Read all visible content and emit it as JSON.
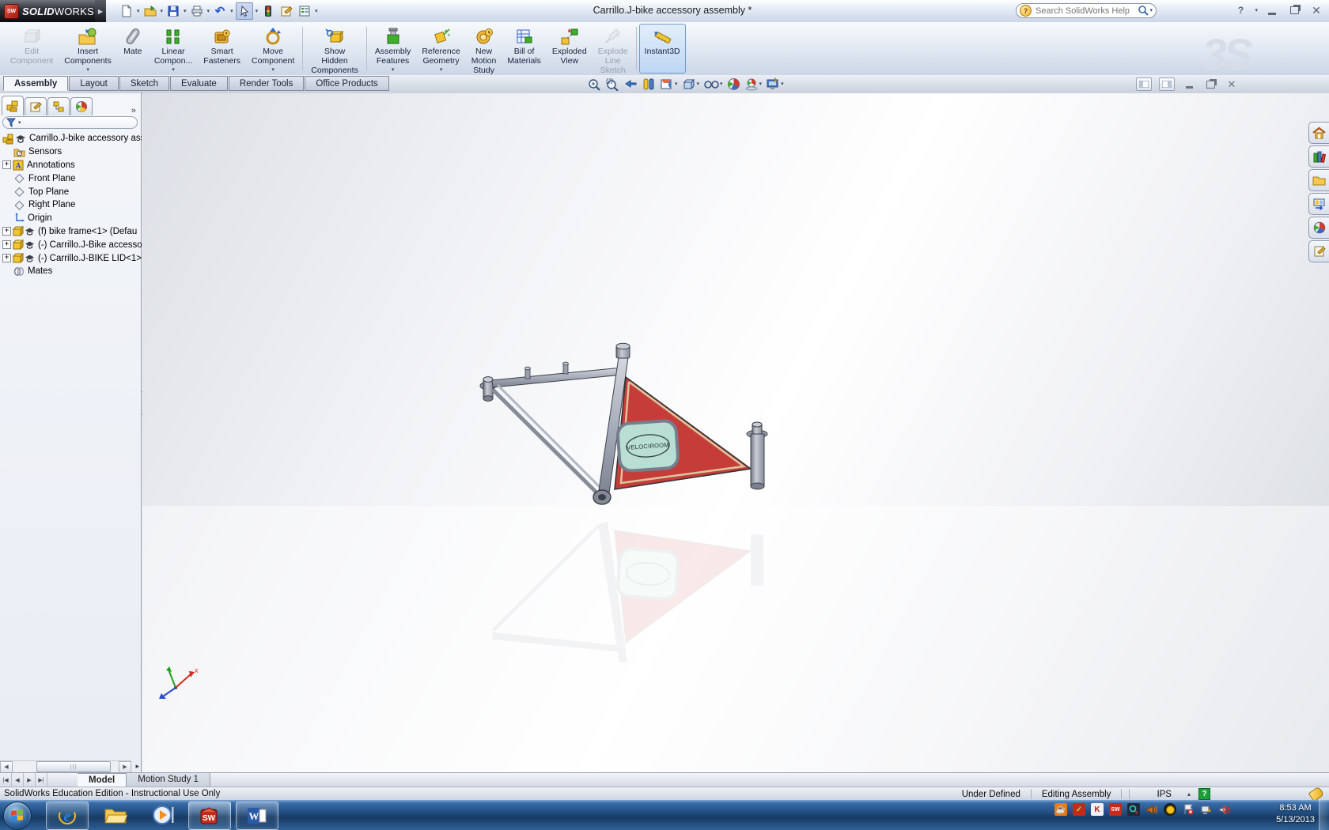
{
  "titlebar": {
    "logo_bold": "SOLID",
    "logo_light": "WORKS",
    "title": "Carrillo.J-bike accessory assembly *",
    "search_placeholder": "Search SolidWorks Help"
  },
  "ribbon": {
    "buttons": [
      {
        "label": "Edit\nComponent"
      },
      {
        "label": "Insert\nComponents"
      },
      {
        "label": "Mate"
      },
      {
        "label": "Linear\nCompon..."
      },
      {
        "label": "Smart\nFasteners"
      },
      {
        "label": "Move\nComponent"
      },
      {
        "label": "Show\nHidden\nComponents"
      },
      {
        "label": "Assembly\nFeatures"
      },
      {
        "label": "Reference\nGeometry"
      },
      {
        "label": "New\nMotion\nStudy"
      },
      {
        "label": "Bill of\nMaterials"
      },
      {
        "label": "Exploded\nView"
      },
      {
        "label": "Explode\nLine\nSketch"
      },
      {
        "label": "Instant3D"
      }
    ],
    "watermark": "3S"
  },
  "command_tabs": [
    "Assembly",
    "Layout",
    "Sketch",
    "Evaluate",
    "Render Tools",
    "Office Products"
  ],
  "tree": {
    "items": [
      "Carrillo.J-bike accessory asse",
      "Sensors",
      "Annotations",
      "Front Plane",
      "Top Plane",
      "Right Plane",
      "Origin",
      "(f) bike frame<1> (Defau",
      "(-) Carrillo.J-Bike accesso",
      "(-) Carrillo.J-BIKE LID<1>",
      "Mates"
    ]
  },
  "viewport": {
    "model_logo": "VELOCIROOM",
    "triad_x_label": "x"
  },
  "bottom_tabs": {
    "model": "Model",
    "motion_study": "Motion Study 1"
  },
  "statusbar": {
    "left": "SolidWorks Education Edition - Instructional Use Only",
    "constraint": "Under Defined",
    "mode": "Editing Assembly",
    "units": "IPS"
  },
  "taskbar": {
    "clock_time": "8:53 AM",
    "clock_date": "5/13/2013"
  }
}
